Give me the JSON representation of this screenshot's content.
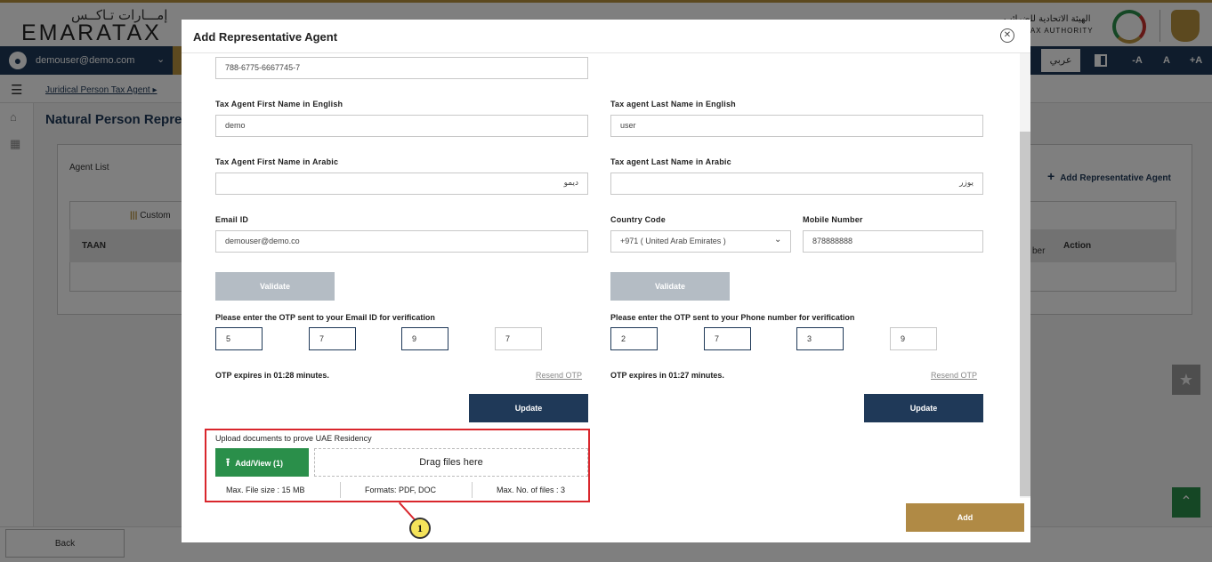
{
  "header": {
    "logo_ar": "إمـــارات تـاكــس",
    "logo_en": "EMARATAX",
    "fta_ar": "الهيئة الاتحادية للضرائب",
    "fta_en": "AL TAX AUTHORITY"
  },
  "navbar": {
    "user_email": "demouser@demo.com",
    "language_label": "عربي",
    "font_decrease": "-A",
    "font_normal": "A",
    "font_increase": "+A"
  },
  "breadcrumb": "Juridical Person Tax Agent",
  "page": {
    "title": "Natural Person Repre",
    "agent_list_label": "Agent List",
    "add_rep_label": "Add Representative Agent",
    "table": {
      "custom_label": "Custom",
      "col_taan": "TAAN",
      "col_ber": "ber",
      "col_action": "Action"
    },
    "back_label": "Back"
  },
  "modal": {
    "title": "Add Representative Agent",
    "top_value": "788-6775-6667745-7",
    "first_name_en_label": "Tax Agent First Name in English",
    "first_name_en_value": "demo",
    "last_name_en_label": "Tax agent Last Name in English",
    "last_name_en_value": "user",
    "first_name_ar_label": "Tax Agent First Name in Arabic",
    "first_name_ar_value": "ديمو",
    "last_name_ar_label": "Tax agent Last Name in Arabic",
    "last_name_ar_value": "يوزر",
    "email_label": "Email ID",
    "email_value": "demouser@demo.co",
    "country_code_label": "Country Code",
    "country_code_value": "+971 ( United Arab Emirates )",
    "mobile_label": "Mobile Number",
    "mobile_value": "878888888",
    "validate_label": "Validate",
    "email_otp_label": "Please enter the OTP sent to your Email ID for verification",
    "email_otp": [
      "5",
      "7",
      "9",
      "7"
    ],
    "phone_otp_label": "Please enter the OTP sent to your Phone number for verification",
    "phone_otp": [
      "2",
      "7",
      "3",
      "9"
    ],
    "email_expire": "OTP expires in 01:28 minutes.",
    "phone_expire": "OTP expires in 01:27 minutes.",
    "resend_label": "Resend OTP",
    "update_label": "Update",
    "upload_label": "Upload documents to prove UAE Residency",
    "upload_button": "Add/View (1)",
    "drag_label": "Drag files here",
    "max_size": "Max. File size : 15 MB",
    "formats": "Formats: PDF, DOC",
    "max_files": "Max. No. of files : 3",
    "callout_number": "1",
    "add_label": "Add"
  },
  "colors": {
    "navy": "#1f3958",
    "gold": "#b8923f",
    "green": "#2a8f4a",
    "highlight_red": "#d9262c"
  }
}
